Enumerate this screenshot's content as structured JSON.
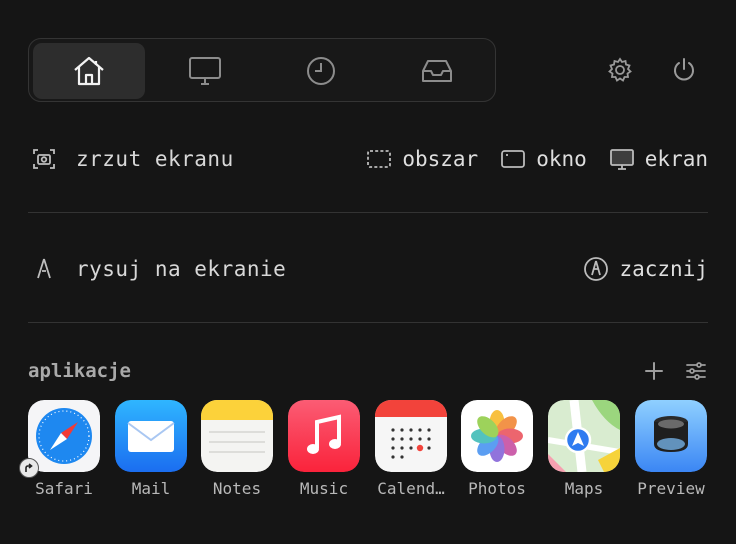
{
  "tabs": [
    {
      "name": "home",
      "icon": "house-icon",
      "active": true
    },
    {
      "name": "display",
      "icon": "monitor-icon",
      "active": false
    },
    {
      "name": "history",
      "icon": "clock-icon",
      "active": false
    },
    {
      "name": "inbox",
      "icon": "tray-icon",
      "active": false
    }
  ],
  "toolbar": {
    "settings_icon": "gear-icon",
    "power_icon": "power-icon"
  },
  "screenshot": {
    "label": "zrzut ekranu",
    "options": [
      {
        "label": "obszar",
        "icon": "dashed-rect-icon"
      },
      {
        "label": "okno",
        "icon": "window-icon"
      },
      {
        "label": "ekran",
        "icon": "monitor-icon"
      }
    ]
  },
  "draw": {
    "label": "rysuj na ekranie",
    "start_label": "zacznij"
  },
  "apps": {
    "title": "aplikacje",
    "items": [
      {
        "name": "Safari",
        "alias": true
      },
      {
        "name": "Mail"
      },
      {
        "name": "Notes"
      },
      {
        "name": "Music"
      },
      {
        "name": "Calend…"
      },
      {
        "name": "Photos"
      },
      {
        "name": "Maps"
      },
      {
        "name": "Preview"
      }
    ]
  },
  "colors": {
    "background": "#151515",
    "active_tab": "#2d2d2d",
    "divider": "#333333"
  }
}
